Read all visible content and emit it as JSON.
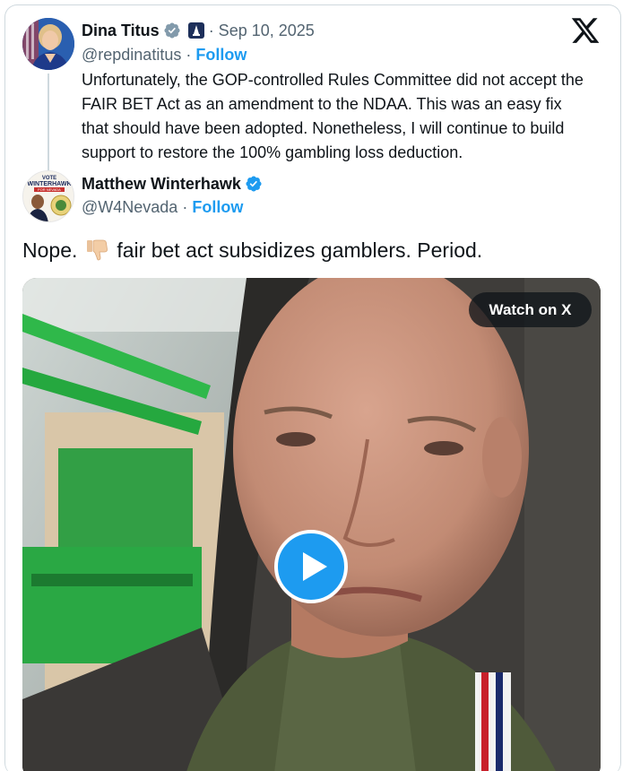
{
  "quoted_tweet": {
    "display_name": "Dina Titus",
    "date": "· Sep 10, 2025",
    "handle": "@repdinatitus",
    "separator": " · ",
    "follow_label": "Follow",
    "text": "Unfortunately, the GOP-controlled Rules Committee did not accept the FAIR BET Act as an amendment to the NDAA. This was an easy fix that should have been adopted. Nonetheless, I will continue to build support  to restore the 100% gambling loss deduction."
  },
  "main_tweet": {
    "display_name": "Matthew Winterhawk",
    "handle": "@W4Nevada",
    "separator": " · ",
    "follow_label": "Follow",
    "text_before": "Nope.",
    "emoji": "thumbs-down",
    "text_after": "fair bet act subsidizes gamblers. Period.",
    "avatar_sign_lines": [
      "VOTE",
      "WINTERHAWK",
      "FOR NEVADA"
    ]
  },
  "video": {
    "watch_label": "Watch on X",
    "play_icon": "play-icon"
  },
  "icons": {
    "platform": "x-logo-icon",
    "verified": "verified-badge-icon",
    "government": "government-badge-icon"
  },
  "colors": {
    "link": "#1d9bf0",
    "text": "#0f1419",
    "secondary": "#536471",
    "border": "#cfd9de"
  }
}
